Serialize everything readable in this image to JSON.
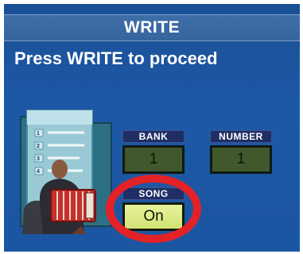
{
  "dialog": {
    "title": "WRITE",
    "instruction": "Press WRITE to proceed"
  },
  "params": {
    "bank": {
      "label": "BANK",
      "value": "1"
    },
    "number": {
      "label": "NUMBER",
      "value": "1"
    },
    "song": {
      "label": "SONG",
      "value": "On"
    }
  },
  "illustration": {
    "list_numbers": [
      "1",
      "2",
      "3",
      "4"
    ]
  },
  "colors": {
    "screen_bg": "#1d58a6",
    "header_bg": "#3a6aa3",
    "label_bg": "#1f2f66",
    "value_box_inactive": "#40582c",
    "value_box_active": "#d9e67f",
    "highlight_ring": "#e32227"
  },
  "icons": [
    "song-list-icon",
    "accordion-player-icon",
    "highlight-ring"
  ]
}
